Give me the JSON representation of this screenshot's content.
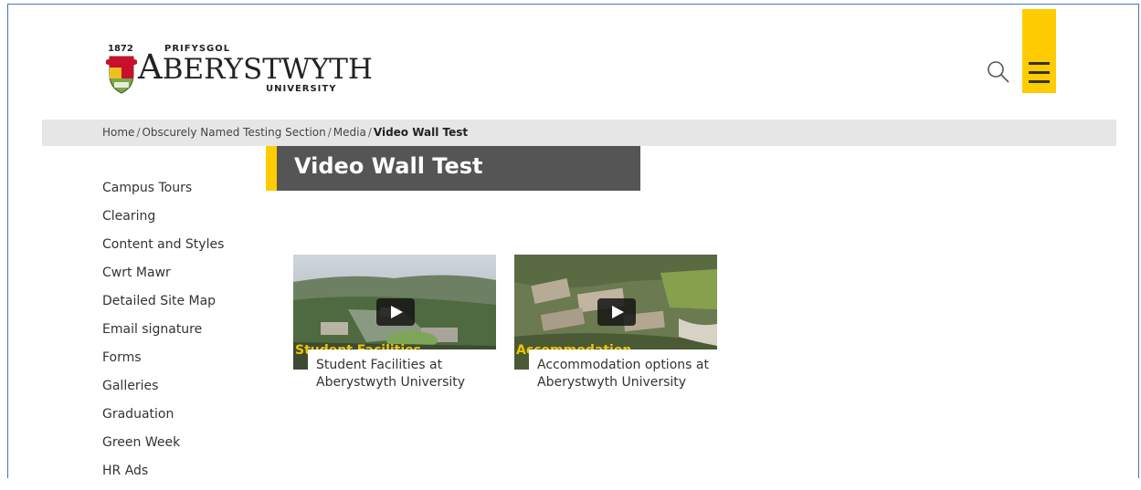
{
  "header": {
    "logo": {
      "year": "1872",
      "prifysgol": "PRIFYSGOL",
      "wordmark_initial": "A",
      "wordmark_rest": "BERYSTWYTH",
      "university": "UNIVERSITY"
    },
    "icons": {
      "search": "search-icon",
      "menu": "hamburger-menu-icon"
    },
    "colors": {
      "accent": "#fecc00",
      "title_bg": "#555555",
      "breadcrumb_bg": "#e6e6e6"
    }
  },
  "breadcrumb": {
    "items": [
      "Home",
      "Obscurely Named Testing Section",
      "Media"
    ],
    "separator": "/",
    "current": "Video Wall Test"
  },
  "sidebar": {
    "items": [
      "Campus Tours",
      "Clearing",
      "Content and Styles",
      "Cwrt Mawr",
      "Detailed Site Map",
      "Email signature",
      "Forms",
      "Galleries",
      "Graduation",
      "Green Week",
      "HR Ads"
    ]
  },
  "main": {
    "title": "Video Wall Test",
    "videos": [
      {
        "overlay": "Student Facilities",
        "caption": "Student Facilities at Aberystwyth University",
        "play_icon": "play-icon"
      },
      {
        "overlay": "Accommodation",
        "caption": "Accommodation options at Aberystwyth University",
        "play_icon": "play-icon"
      }
    ]
  }
}
